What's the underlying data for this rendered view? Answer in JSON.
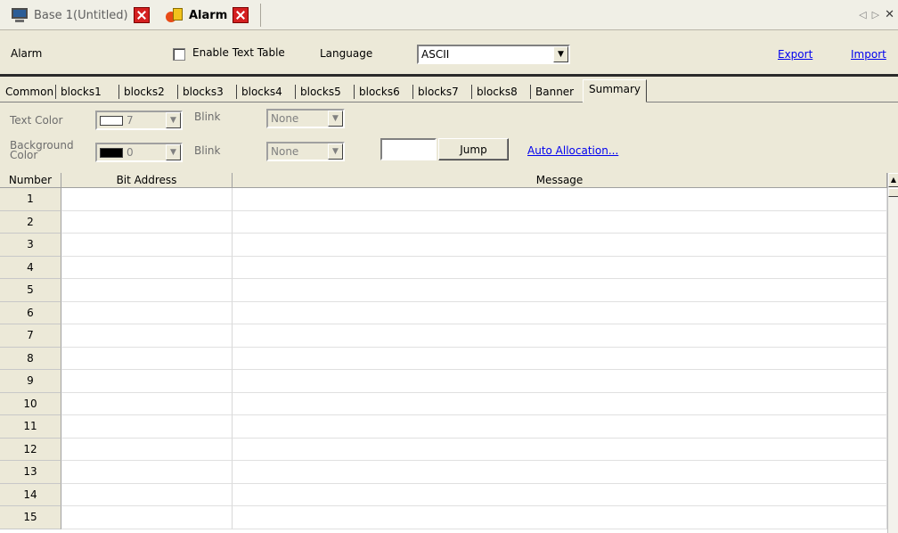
{
  "doc_tabs": {
    "tab1_label": "Base 1(Untitled)",
    "tab1_icon": "monitor-icon",
    "tab2_label": "Alarm",
    "tab2_icon": "alarm-icon"
  },
  "header": {
    "title": "Alarm",
    "enable_text_table_label": "Enable Text Table",
    "enable_text_table_checked": false,
    "language_label": "Language",
    "language_value": "ASCII",
    "export_label": "Export",
    "import_label": "Import"
  },
  "prop_tabs": [
    "Common",
    "blocks1",
    "blocks2",
    "blocks3",
    "blocks4",
    "blocks5",
    "blocks6",
    "blocks7",
    "blocks8",
    "Banner",
    "Summary"
  ],
  "prop_tabs_selected": "Summary",
  "settings": {
    "text_color_label": "Text Color",
    "text_color_value": "7",
    "text_color_swatch": "#ffffff",
    "blink_label": "Blink",
    "blink1_value": "None",
    "background_color_label": "Background Color",
    "background_color_value": "0",
    "background_color_swatch": "#000000",
    "blink2_value": "None",
    "jump_label": "Jump",
    "auto_allocation_label": "Auto Allocation..."
  },
  "grid": {
    "columns": [
      "Number",
      "Bit Address",
      "Message"
    ],
    "rows": [
      "1",
      "2",
      "3",
      "4",
      "5",
      "6",
      "7",
      "8",
      "9",
      "10",
      "11",
      "12",
      "13",
      "14",
      "15"
    ]
  }
}
